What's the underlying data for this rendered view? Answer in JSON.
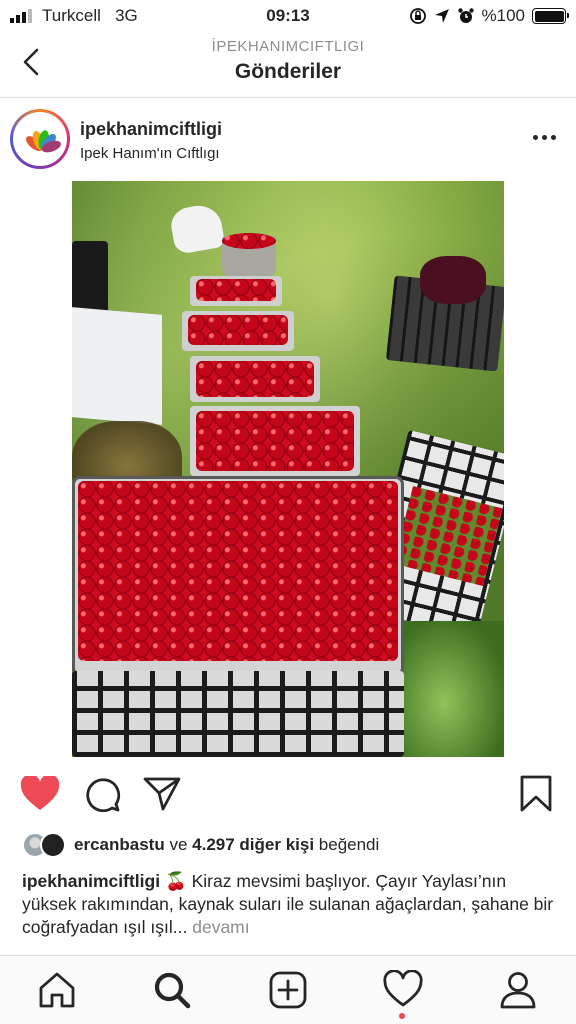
{
  "status_bar": {
    "carrier": "Turkcell",
    "network": "3G",
    "time": "09:13",
    "battery": "%100"
  },
  "header": {
    "account": "İPEKHANIMCIFTLIGI",
    "title": "Gönderiler"
  },
  "post": {
    "username": "ipekhanimciftligi",
    "location": "Ipek Hanım'ın Cıftlıgı",
    "likes": {
      "first_liker": "ercanbastu",
      "connector": "ve",
      "count_text": "4.297 diğer kişi",
      "suffix": "beğendi"
    },
    "caption": {
      "username": "ipekhanimciftligi",
      "emoji": "🍒",
      "text": "Kiraz mevsimi başlıyor. Çayır Yaylası’nın yüksek rakımından, kaynak suları ile sulanan ağaçlardan, şahane bir coğrafyadan ışıl ışıl...",
      "more": "devamı"
    }
  },
  "colors": {
    "like_red": "#ed4956",
    "text": "#262626",
    "muted": "#8e8e8e",
    "divider": "#dbdbdb"
  },
  "icons": {
    "actions": [
      "heart-filled-icon",
      "comment-icon",
      "share-icon",
      "bookmark-icon"
    ],
    "tabs": [
      "home-icon",
      "search-icon",
      "add-post-icon",
      "activity-heart-icon",
      "profile-icon"
    ]
  }
}
